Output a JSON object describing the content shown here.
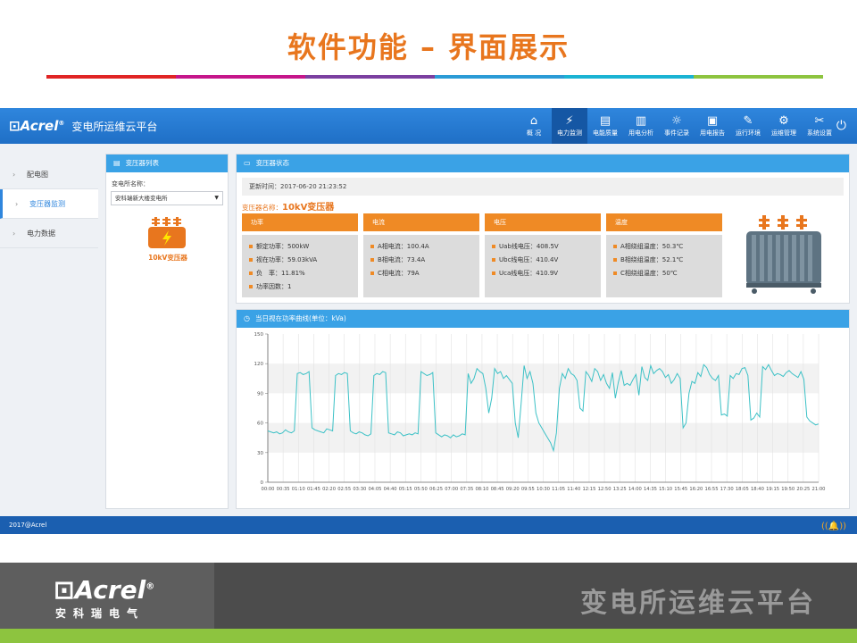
{
  "slide": {
    "title": "软件功能 – 界面展示",
    "color_bar": [
      "#e02424",
      "#c5168a",
      "#7b3fa0",
      "#2b9bd6",
      "#1ab3d3",
      "#8dc43f"
    ],
    "footer_logo": "Acrel",
    "footer_logo_reg": "®",
    "footer_logo_sub": "安科瑞电气",
    "footer_title": "变电所运维云平台"
  },
  "app": {
    "logo": "Acrel",
    "logo_reg": "®",
    "title": "变电所运维云平台",
    "nav": [
      {
        "label": "概 况",
        "icon": "⌂"
      },
      {
        "label": "电力监测",
        "icon": "⚡"
      },
      {
        "label": "电能质量",
        "icon": "▤"
      },
      {
        "label": "用电分析",
        "icon": "▥"
      },
      {
        "label": "事件记录",
        "icon": "☼"
      },
      {
        "label": "用电报告",
        "icon": "▣"
      },
      {
        "label": "运行环境",
        "icon": "✎"
      },
      {
        "label": "运维管理",
        "icon": "⚙"
      },
      {
        "label": "系统设置",
        "icon": "✂"
      }
    ],
    "active_nav": 1,
    "power_icon": "⏻",
    "sidebar": [
      {
        "label": "配电图"
      },
      {
        "label": "变压器监测"
      },
      {
        "label": "电力数据"
      }
    ],
    "active_side": 1,
    "list_panel": {
      "title": "变压器列表",
      "field_label": "变电所名称：",
      "selected_station": "安科瑞新大楼变电所",
      "transformer_label": "10kV变压器"
    },
    "status_panel": {
      "title": "变压器状态",
      "update_time": "更新时间：2017-06-20 21:23:52",
      "name_prefix": "变压器名称：",
      "name": "10kV变压器",
      "cards": [
        {
          "title": "功率",
          "rows": [
            "额定功率：500kW",
            "视在功率：59.03kVA",
            "负　率：11.81%",
            "功率因数：1"
          ]
        },
        {
          "title": "电流",
          "rows": [
            "A相电流：100.4A",
            "B相电流：73.4A",
            "C相电流：79A"
          ]
        },
        {
          "title": "电压",
          "rows": [
            "Uab线电压：408.5V",
            "Ubc线电压：410.4V",
            "Uca线电压：410.9V"
          ]
        },
        {
          "title": "温度",
          "rows": [
            "A相绕组温度：50.3℃",
            "B相绕组温度：52.1℃",
            "C相绕组温度：50℃"
          ]
        }
      ]
    },
    "curve_panel": {
      "title": "当日视在功率曲线(单位：kVa)"
    },
    "footer": "2017@Acrel"
  },
  "chart_data": {
    "type": "line",
    "title": "当日视在功率曲线(单位：kVa)",
    "ylim": [
      0,
      150
    ],
    "yticks": [
      0,
      30,
      60,
      90,
      120,
      150
    ],
    "x_tick_labels": [
      "00:00",
      "00:35",
      "01:10",
      "01:45",
      "02:20",
      "02:55",
      "03:30",
      "04:05",
      "04:40",
      "05:15",
      "05:50",
      "06:25",
      "07:00",
      "07:35",
      "08:10",
      "08:45",
      "09:20",
      "09:55",
      "10:30",
      "11:05",
      "11:40",
      "12:15",
      "12:50",
      "13:25",
      "14:00",
      "14:35",
      "15:10",
      "15:45",
      "16:20",
      "16:55",
      "17:30",
      "18:05",
      "18:40",
      "19:15",
      "19:50",
      "20:25",
      "21:00"
    ],
    "series": [
      {
        "color": "#3cc1c6",
        "values": [
          52,
          51,
          50,
          51,
          49,
          50,
          53,
          51,
          50,
          52,
          110,
          111,
          109,
          110,
          112,
          55,
          53,
          52,
          51,
          50,
          54,
          53,
          52,
          108,
          110,
          109,
          111,
          110,
          52,
          50,
          49,
          51,
          50,
          48,
          47,
          49,
          108,
          110,
          109,
          112,
          111,
          50,
          49,
          48,
          51,
          50,
          47,
          48,
          49,
          48,
          50,
          49,
          112,
          110,
          108,
          109,
          111,
          50,
          48,
          46,
          48,
          47,
          45,
          48,
          46,
          47,
          49,
          48,
          110,
          100,
          105,
          115,
          112,
          110,
          95,
          70,
          85,
          115,
          110,
          112,
          105,
          108,
          104,
          100,
          60,
          45,
          80,
          118,
          105,
          112,
          100,
          70,
          60,
          55,
          50,
          45,
          40,
          32,
          50,
          95,
          110,
          105,
          115,
          110,
          108,
          103,
          75,
          72,
          112,
          108,
          102,
          115,
          112,
          103,
          109,
          100,
          95,
          111,
          85,
          101,
          113,
          98,
          100,
          98,
          104,
          109,
          88,
          117,
          106,
          103,
          118,
          110,
          113,
          115,
          112,
          106,
          109,
          100,
          104,
          110,
          105,
          55,
          60,
          90,
          102,
          100,
          111,
          107,
          119,
          116,
          109,
          105,
          103,
          108,
          68,
          69,
          67,
          108,
          105,
          110,
          109,
          115,
          116,
          108,
          63,
          65,
          70,
          66,
          117,
          114,
          119,
          113,
          108,
          110,
          109,
          107,
          111,
          113,
          110,
          108,
          106,
          112,
          104,
          66,
          62,
          60,
          58,
          59
        ]
      }
    ]
  }
}
